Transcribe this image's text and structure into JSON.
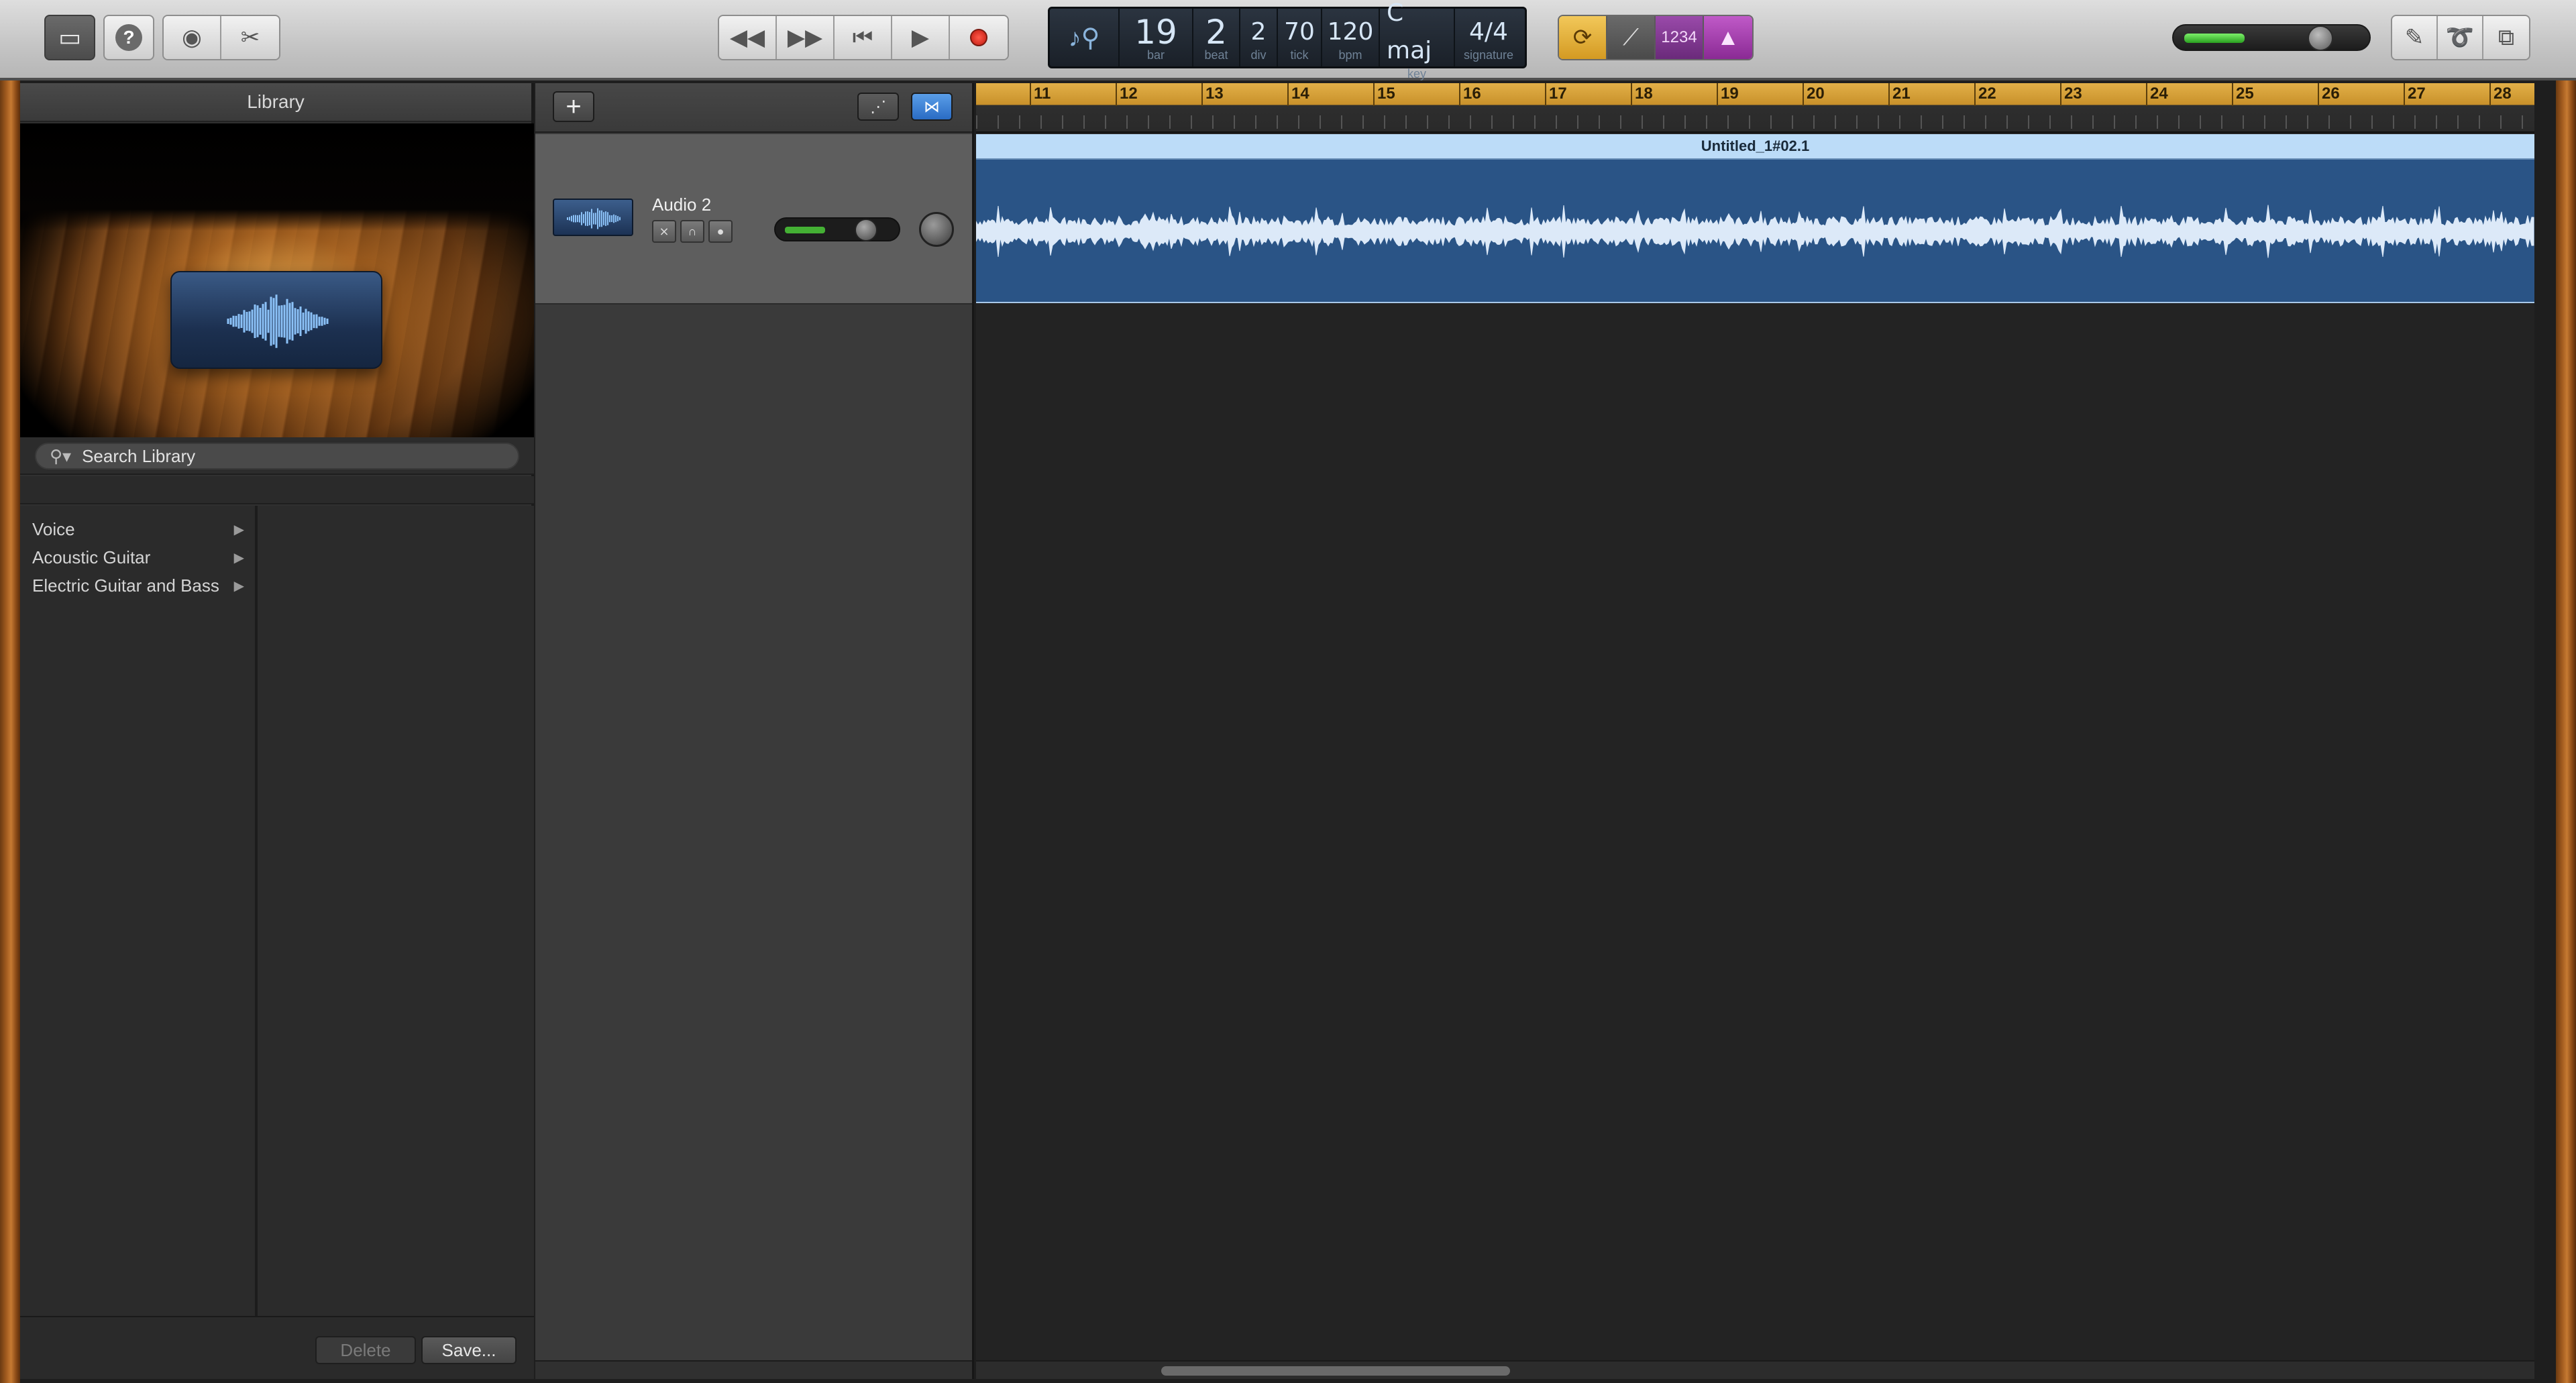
{
  "toolbar": {
    "left_buttons": [
      "library-icon",
      "help-icon",
      "smart-controls-icon",
      "editors-icon"
    ],
    "transport": [
      "rewind-icon",
      "fast-forward-icon",
      "go-to-beginning-icon",
      "play-icon",
      "record-icon"
    ],
    "lcd": {
      "bar": "19",
      "bar_label": "bar",
      "beat": "2",
      "beat_label": "beat",
      "div": "2",
      "div_label": "div",
      "tick": "70",
      "tick_label": "tick",
      "bpm": "120",
      "bpm_label": "bpm",
      "key": "C maj",
      "key_label": "key",
      "signature": "4/4",
      "signature_label": "signature"
    },
    "modes": {
      "count_in": "1234"
    },
    "colors": {
      "cycle": "#e8b23a",
      "count_in": "#8a3a9a",
      "metronome": "#b04ab8"
    }
  },
  "library": {
    "title": "Library",
    "search_placeholder": "Search Library",
    "categories": [
      "Voice",
      "Acoustic Guitar",
      "Electric Guitar and Bass"
    ],
    "delete_label": "Delete",
    "save_label": "Save..."
  },
  "tracks": [
    {
      "name": "Audio 2",
      "volume": 0.6
    }
  ],
  "ruler": {
    "bars": [
      "11",
      "12",
      "13",
      "14",
      "15",
      "16",
      "17",
      "18",
      "19",
      "20",
      "21",
      "22",
      "23",
      "24",
      "25",
      "26",
      "27",
      "28"
    ]
  },
  "region": {
    "name": "Untitled_1#02.1",
    "color": "#2a5486",
    "header_color": "#bcdcf8"
  },
  "master_volume": 0.3
}
